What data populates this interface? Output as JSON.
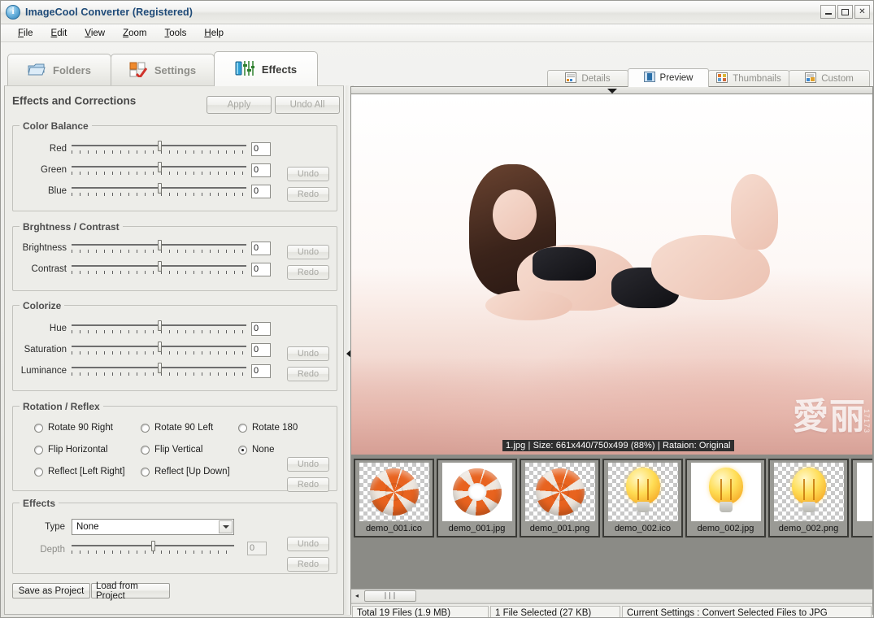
{
  "window": {
    "title": "ImageCool Converter  (Registered)",
    "app_icon": "info-circle-icon",
    "minimize_label": "",
    "maximize_label": "",
    "close_label": "✕"
  },
  "menu": {
    "items": [
      {
        "label": "File",
        "accel": "F"
      },
      {
        "label": "Edit",
        "accel": "E"
      },
      {
        "label": "View",
        "accel": "V"
      },
      {
        "label": "Zoom",
        "accel": "Z"
      },
      {
        "label": "Tools",
        "accel": "T"
      },
      {
        "label": "Help",
        "accel": "H"
      }
    ]
  },
  "left_tabs": [
    {
      "label": "Folders",
      "icon": "folder-icon",
      "active": false
    },
    {
      "label": "Settings",
      "icon": "checkbox-grid-icon",
      "active": false
    },
    {
      "label": "Effects",
      "icon": "sliders-icon",
      "active": true
    }
  ],
  "right_tabs": [
    {
      "label": "Details",
      "icon": "list-details-icon",
      "active": false
    },
    {
      "label": "Preview",
      "icon": "image-preview-icon",
      "active": true
    },
    {
      "label": "Thumbnails",
      "icon": "grid-thumbnails-icon",
      "active": false
    },
    {
      "label": "Custom",
      "icon": "custom-view-icon",
      "active": false
    }
  ],
  "panel": {
    "title": "Effects and Corrections",
    "apply_label": "Apply",
    "undo_all_label": "Undo All",
    "undo_label": "Undo",
    "redo_label": "Redo"
  },
  "color_balance": {
    "legend": "Color Balance",
    "sliders": [
      {
        "label": "Red",
        "value": "0"
      },
      {
        "label": "Green",
        "value": "0"
      },
      {
        "label": "Blue",
        "value": "0"
      }
    ],
    "undo_label": "Undo",
    "redo_label": "Redo"
  },
  "brightness_contrast": {
    "legend": "Brghtness / Contrast",
    "sliders": [
      {
        "label": "Brightness",
        "value": "0"
      },
      {
        "label": "Contrast",
        "value": "0"
      }
    ],
    "undo_label": "Undo",
    "redo_label": "Redo"
  },
  "colorize": {
    "legend": "Colorize",
    "sliders": [
      {
        "label": "Hue",
        "value": "0"
      },
      {
        "label": "Saturation",
        "value": "0"
      },
      {
        "label": "Luminance",
        "value": "0"
      }
    ],
    "undo_label": "Undo",
    "redo_label": "Redo"
  },
  "rotation": {
    "legend": "Rotation / Reflex",
    "options": [
      {
        "label": "Rotate 90 Right",
        "checked": false
      },
      {
        "label": "Rotate 90 Left",
        "checked": false
      },
      {
        "label": "Rotate 180",
        "checked": false
      },
      {
        "label": "Flip Horizontal",
        "checked": false
      },
      {
        "label": "Flip Vertical",
        "checked": false
      },
      {
        "label": "None",
        "checked": true
      },
      {
        "label": "Reflect [Left Right]",
        "checked": false
      },
      {
        "label": "Reflect [Up Down]",
        "checked": false
      }
    ],
    "undo_label": "Undo",
    "redo_label": "Redo"
  },
  "effects": {
    "legend": "Effects",
    "type_label": "Type",
    "type_value": "None",
    "depth_label": "Depth",
    "depth_value": "0",
    "undo_label": "Undo",
    "redo_label": "Redo"
  },
  "project": {
    "save_label": "Save as Project",
    "load_label": "Load from Project"
  },
  "preview": {
    "caption": "1.jpg  |  Size: 661x440/750x499 (88%)  |  Rataion: Original",
    "watermark": "愛丽",
    "watermark_side": "17173",
    "collapse_down_icon": "chevron-down-icon",
    "collapse_left_icon": "chevron-left-icon"
  },
  "thumbnails": [
    {
      "name": "demo_001.ico",
      "kind": "ring",
      "bg": "alpha"
    },
    {
      "name": "demo_001.jpg",
      "kind": "ring",
      "bg": "white"
    },
    {
      "name": "demo_001.png",
      "kind": "ring",
      "bg": "alpha"
    },
    {
      "name": "demo_002.ico",
      "kind": "bulb",
      "bg": "alpha"
    },
    {
      "name": "demo_002.jpg",
      "kind": "bulb",
      "bg": "white"
    },
    {
      "name": "demo_002.png",
      "kind": "bulb",
      "bg": "alpha"
    },
    {
      "name": "dem",
      "kind": "strip",
      "bg": "white"
    }
  ],
  "thumb_scroll": {
    "left_arrow": "◂",
    "grip": "∣∣∣"
  },
  "statusbar": {
    "total": "Total 19 Files (1.9 MB)",
    "selected": "1 File Selected (27 KB)",
    "settings": "Current Settings : Convert Selected Files to JPG"
  },
  "colors": {
    "title_text": "#1e4a78",
    "panel_bg": "#edede9",
    "thumb_bg": "#8b8b86",
    "accent_orange": "#e8631f",
    "accent_yellow": "#ffdd55"
  }
}
